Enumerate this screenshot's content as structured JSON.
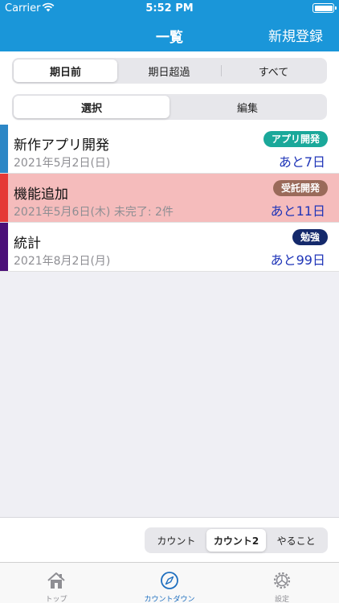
{
  "status_bar": {
    "carrier": "Carrier",
    "time": "5:52 PM"
  },
  "nav": {
    "title": "一覧",
    "right_button": "新規登録"
  },
  "period_filter": {
    "items": [
      "期日前",
      "期日超過",
      "すべて"
    ],
    "selected_index": 0
  },
  "mode_toggle": {
    "items": [
      "選択",
      "編集"
    ],
    "selected_index": 0
  },
  "tasks": [
    {
      "title": "新作アプリ開発",
      "date": "2021年5月2日(日)",
      "tag": "アプリ開発",
      "tag_color": "#1aa89a",
      "remaining": "あと7日",
      "bar_color": "#2d87c6",
      "highlight": false
    },
    {
      "title": "機能追加",
      "date": "2021年5月6日(木)  未完了: 2件",
      "tag": "受託開発",
      "tag_color": "#9a6a5a",
      "remaining": "あと11日",
      "bar_color": "#e53935",
      "highlight": true
    },
    {
      "title": "統計",
      "date": "2021年8月2日(月)",
      "tag": "勉強",
      "tag_color": "#14296b",
      "remaining": "あと99日",
      "bar_color": "#4b1078",
      "highlight": false
    }
  ],
  "count_mode": {
    "items": [
      "カウント",
      "カウント2",
      "やること"
    ],
    "selected_index": 1
  },
  "tabbar": {
    "items": [
      {
        "label": "トップ",
        "icon": "house-icon"
      },
      {
        "label": "カウントダウン",
        "icon": "compass-icon"
      },
      {
        "label": "設定",
        "icon": "gear-icon"
      }
    ],
    "active_index": 1
  },
  "colors": {
    "header": "#1a96d9",
    "accent": "#1f35b8",
    "alert_row": "#f5bcbc"
  }
}
